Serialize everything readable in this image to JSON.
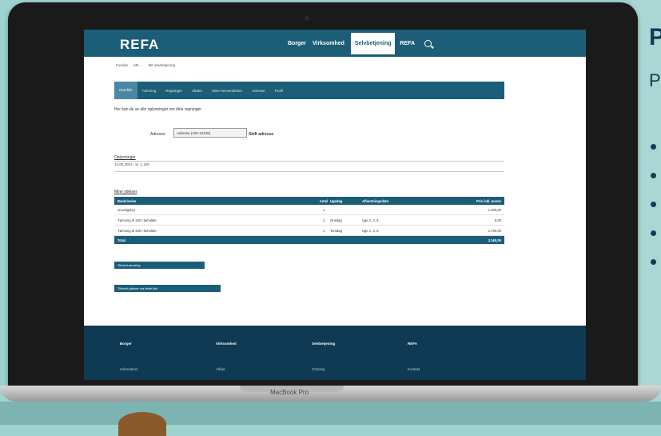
{
  "slide": {
    "title": "P",
    "subtitle": "P",
    "bullet_count": 5
  },
  "laptop": {
    "model_label": "MacBook Pro"
  },
  "site": {
    "logo": "REFA",
    "nav": [
      {
        "label": "Borger",
        "active": false
      },
      {
        "label": "Virksomhed",
        "active": false
      },
      {
        "label": "Selvbetjening",
        "active": true
      },
      {
        "label": "REFA",
        "active": false
      }
    ],
    "search_icon": "search-icon",
    "breadcrumb": [
      "Forside",
      "Mit ...",
      "Mit selvbetjening"
    ],
    "tabs": [
      "Overblik",
      "Tømning",
      "Regninger",
      "Aftaler",
      "Mine henvendelser",
      "Adresse",
      "Profil"
    ],
    "intro": "Her kan du se alle oplysninger om dine regninger",
    "select_label": "Adresse:",
    "select_value": "Adresse (100-12345)",
    "select_extra": "Skift adresse",
    "section1_title": "Oplysninger",
    "section1_line": "14.05.2021 - kr. 1.100",
    "section2_title": "Mine ydelser",
    "table": {
      "headers": [
        "Beskrivelse",
        "Antal",
        "Ugedag",
        "Afhentningsdato",
        "Pris inkl. moms"
      ],
      "rows": [
        [
          "Grundgebyr",
          "1",
          "",
          "",
          "1.400,00"
        ],
        [
          "Tømning af 240 l beholder",
          "1",
          "Onsdag",
          "Uge 2, 4, 6",
          "0,00"
        ],
        [
          "Tømning af 240 l beholder",
          "1",
          "Torsdag",
          "Uge 1, 3, 5",
          "1.760,00"
        ]
      ],
      "total_label": "Total",
      "total_value": "3.160,00"
    },
    "buttons": [
      "Tilmeld ændring",
      "Tilmeld ydelser via dette link"
    ],
    "footer": {
      "columns": [
        "Borger",
        "Virksomhed",
        "Selvbetjening",
        "REFA"
      ],
      "subs": [
        "Information",
        "Affald",
        "Ordning",
        "Kontakt"
      ]
    }
  }
}
